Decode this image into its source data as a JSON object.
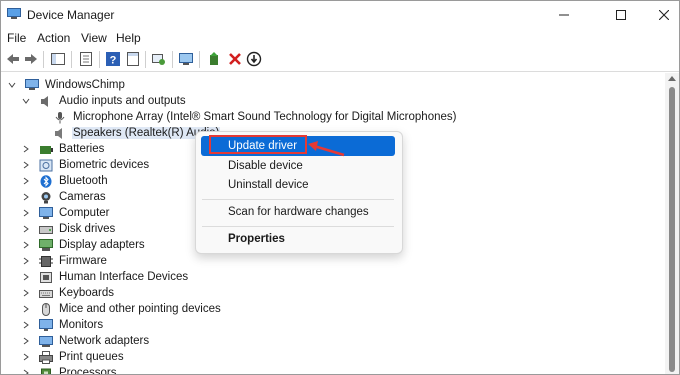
{
  "window": {
    "title": "Device Manager"
  },
  "menu": [
    "File",
    "Action",
    "View",
    "Help"
  ],
  "tree": {
    "root": "WindowsChimp",
    "expanded_category": "Audio inputs and outputs",
    "children": [
      "Microphone Array (Intel® Smart Sound Technology for Digital Microphones)",
      "Speakers (Realtek(R) Audio)"
    ],
    "categories": [
      "Batteries",
      "Biometric devices",
      "Bluetooth",
      "Cameras",
      "Computer",
      "Disk drives",
      "Display adapters",
      "Firmware",
      "Human Interface Devices",
      "Keyboards",
      "Mice and other pointing devices",
      "Monitors",
      "Network adapters",
      "Print queues",
      "Processors"
    ]
  },
  "context_menu": {
    "items": [
      "Update driver",
      "Disable device",
      "Uninstall device",
      "Scan for hardware changes",
      "Properties"
    ],
    "highlighted": "Update driver"
  },
  "colors": {
    "highlight": "#0b6bd6",
    "annotation": "#e53935",
    "selection": "#dfe8f5"
  }
}
